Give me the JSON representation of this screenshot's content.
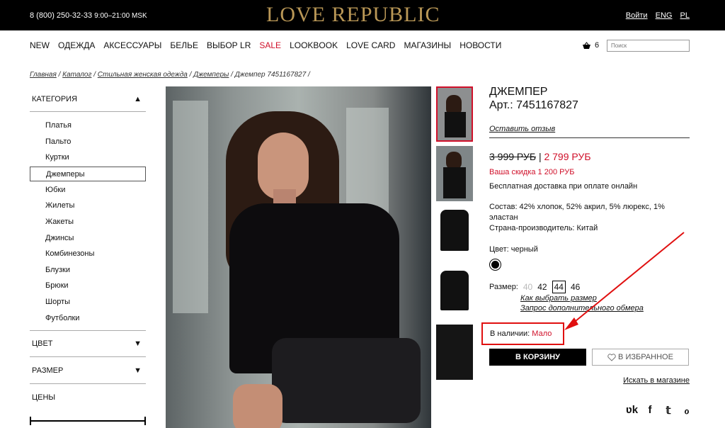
{
  "header": {
    "phone": "8 (800) 250-32-33",
    "hours": "9:00–21:00 MSK",
    "logo_love": "LOVE",
    "logo_republic": "REPUBLIC",
    "links": [
      "Войти",
      "ENG",
      "PL"
    ]
  },
  "nav": {
    "items": [
      "NEW",
      "ОДЕЖДА",
      "АКСЕССУАРЫ",
      "БЕЛЬЕ",
      "ВЫБОР LR",
      "SALE",
      "LOOKBOOK",
      "LOVE CARD",
      "МАГАЗИНЫ",
      "НОВОСТИ"
    ],
    "cart_count": "6",
    "search_placeholder": "Поиск"
  },
  "breadcrumb": [
    "Главная",
    "Каталог",
    "Стильная женская одежда",
    "Джемперы",
    "Джемпер 7451167827"
  ],
  "sidebar": {
    "category_title": "КАТЕГОРИЯ",
    "categories": [
      "Платья",
      "Пальто",
      "Куртки",
      "Джемперы",
      "Юбки",
      "Жилеты",
      "Жакеты",
      "Джинсы",
      "Комбинезоны",
      "Блузки",
      "Брюки",
      "Шорты",
      "Футболки"
    ],
    "active_category": "Джемперы",
    "color_title": "ЦВЕТ",
    "size_title": "РАЗМЕР",
    "price_title": "ЦЕНЫ"
  },
  "product": {
    "name": "ДЖЕМПЕР",
    "article": "Арт.: 7451167827",
    "review_link": "Оставить отзыв",
    "old_price": "3 999 РУБ",
    "separator": "|",
    "new_price": "2 799 РУБ",
    "discount": "Ваша скидка 1 200 РУБ",
    "delivery": "Бесплатная доставка при оплате онлайн",
    "composition": "Состав: 42% хлопок, 52% акрил, 5% люрекс, 1% эластан",
    "country": "Страна-производитель: Китай",
    "color_label": "Цвет: черный",
    "size_label": "Размер:",
    "sizes": [
      "40",
      "42",
      "44",
      "46"
    ],
    "size_guide": "Как выбрать размер",
    "size_request": "Запрос дополнительного обмера",
    "availability_label": "В наличии:",
    "availability_value": "Мало",
    "cart_button": "В КОРЗИНУ",
    "fav_button": "В ИЗБРАННОЕ",
    "store_link": "Искать в магазине"
  },
  "social": [
    "vk-icon",
    "facebook-icon",
    "twitter-icon",
    "odnoklassniki-icon"
  ],
  "colors": {
    "accent": "#d0102a",
    "logo": "#b99756",
    "annotation": "#e01010"
  }
}
